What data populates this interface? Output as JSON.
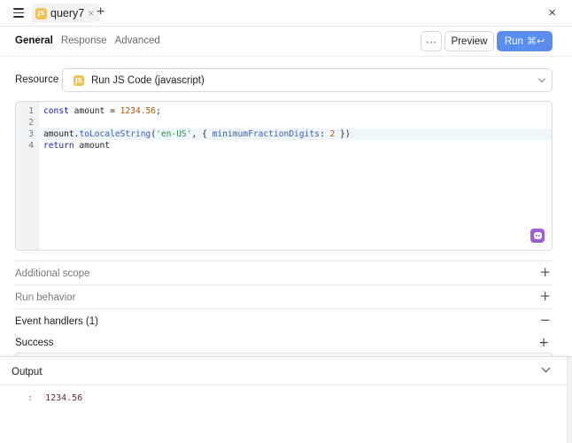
{
  "tab": {
    "badge": "JS",
    "name": "query7",
    "close": "×",
    "add": "+"
  },
  "window": {
    "close": "×"
  },
  "subtabs": [
    "General",
    "Response",
    "Advanced"
  ],
  "toolbar": {
    "more": "···",
    "preview": "Preview",
    "run": "Run",
    "run_shortcut": "⌘↩"
  },
  "resource": {
    "label": "Resource",
    "badge": "JS",
    "value": "Run JS Code (javascript)"
  },
  "editor": {
    "line_numbers": [
      "1",
      "2",
      "3",
      "4"
    ],
    "lines": [
      [
        {
          "t": "const",
          "c": "kw"
        },
        {
          "t": " amount = ",
          "c": ""
        },
        {
          "t": "1234.56",
          "c": "num"
        },
        {
          "t": ";",
          "c": ""
        }
      ],
      [],
      [
        {
          "t": "amount.",
          "c": ""
        },
        {
          "t": "toLocaleString",
          "c": "prop"
        },
        {
          "t": "(",
          "c": ""
        },
        {
          "t": "'en-US'",
          "c": "str"
        },
        {
          "t": ", { ",
          "c": ""
        },
        {
          "t": "minimumFractionDigits",
          "c": "prop"
        },
        {
          "t": ": ",
          "c": ""
        },
        {
          "t": "2",
          "c": "num"
        },
        {
          "t": " })",
          "c": ""
        }
      ],
      [
        {
          "t": "return",
          "c": "kw"
        },
        {
          "t": " amount",
          "c": ""
        }
      ]
    ],
    "active_line": 3
  },
  "sections": {
    "additional_scope": {
      "label": "Additional scope",
      "icon": "+"
    },
    "run_behavior": {
      "label": "Run behavior",
      "icon": "+"
    },
    "event_handlers": {
      "label": "Event handlers (1)",
      "icon": "−"
    }
  },
  "success": {
    "label": "Success",
    "icon": "+"
  },
  "output": {
    "title": "Output",
    "key": ":",
    "value": "1234.56"
  },
  "colors": {
    "accent": "#5b8def",
    "js_badge": "#f1c15a",
    "ai_button": "#a35bd6"
  }
}
